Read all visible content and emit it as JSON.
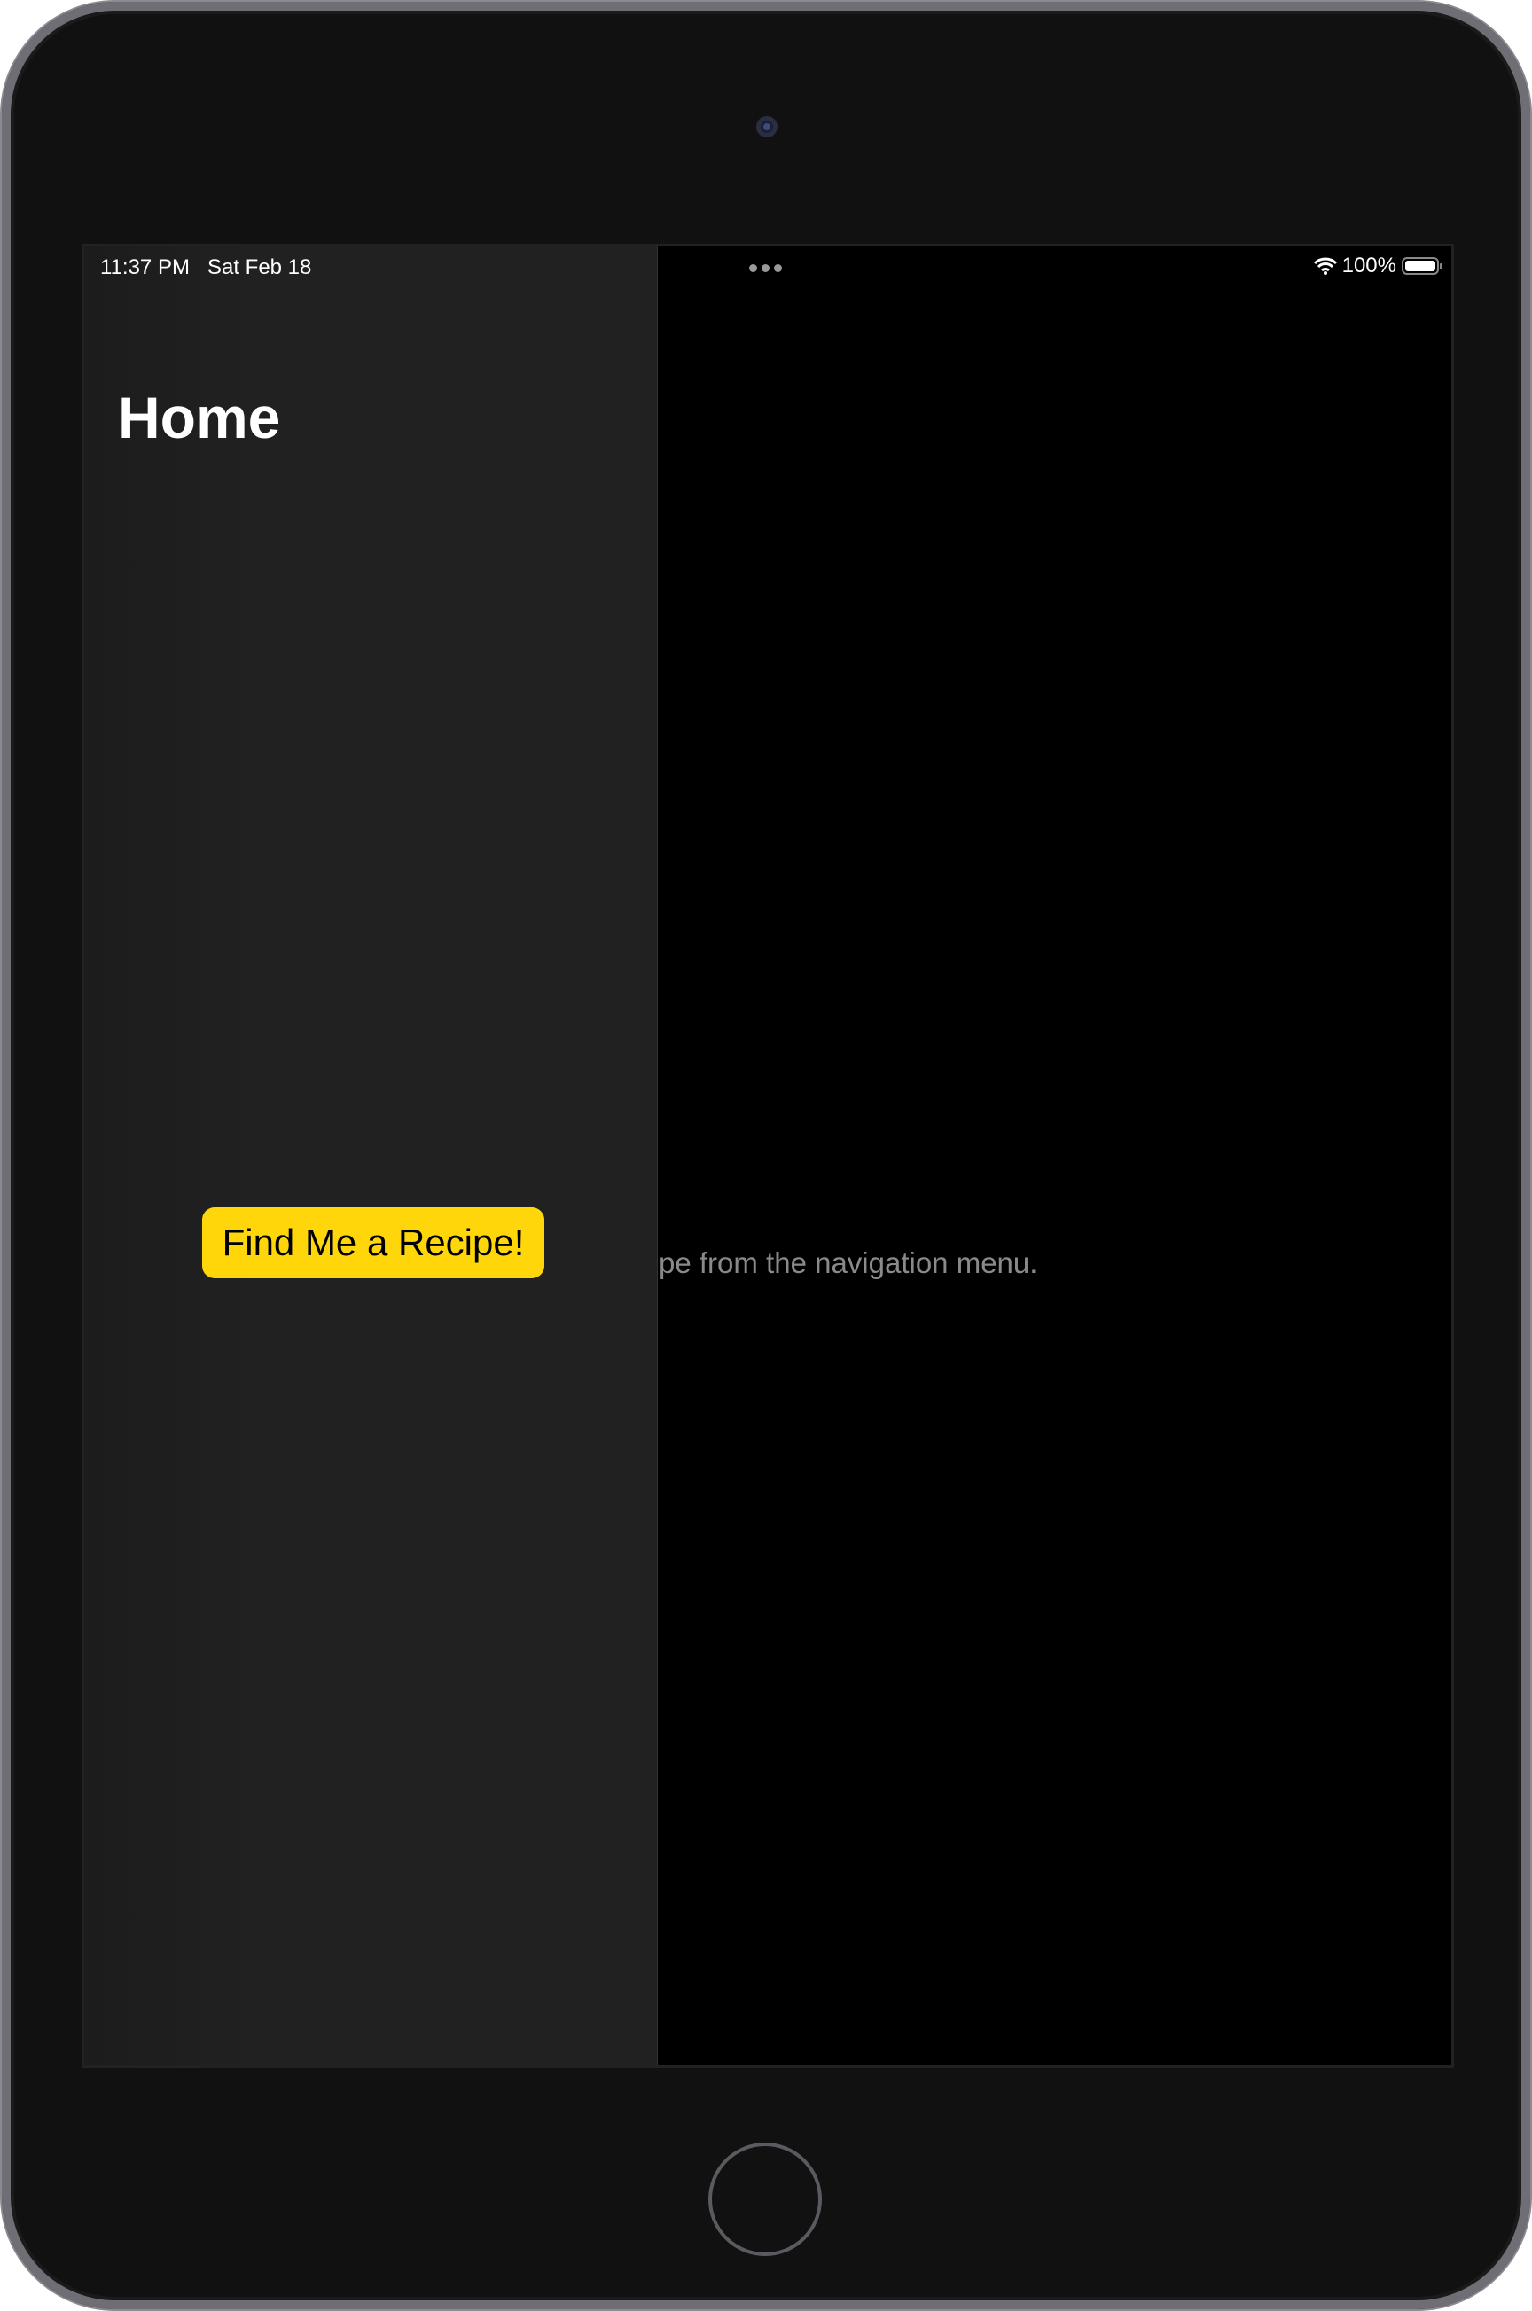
{
  "status_bar": {
    "time": "11:37 PM",
    "date": "Sat Feb 18",
    "battery": "100%",
    "battery_level": 1.0
  },
  "sidebar": {
    "title": "Home",
    "button_label": "Find Me a Recipe!"
  },
  "detail": {
    "placeholder_text": "pe from the navigation menu."
  },
  "colors": {
    "accent": "#FFD60A",
    "sidebar_bg": "#212121",
    "detail_bg": "#000000"
  }
}
